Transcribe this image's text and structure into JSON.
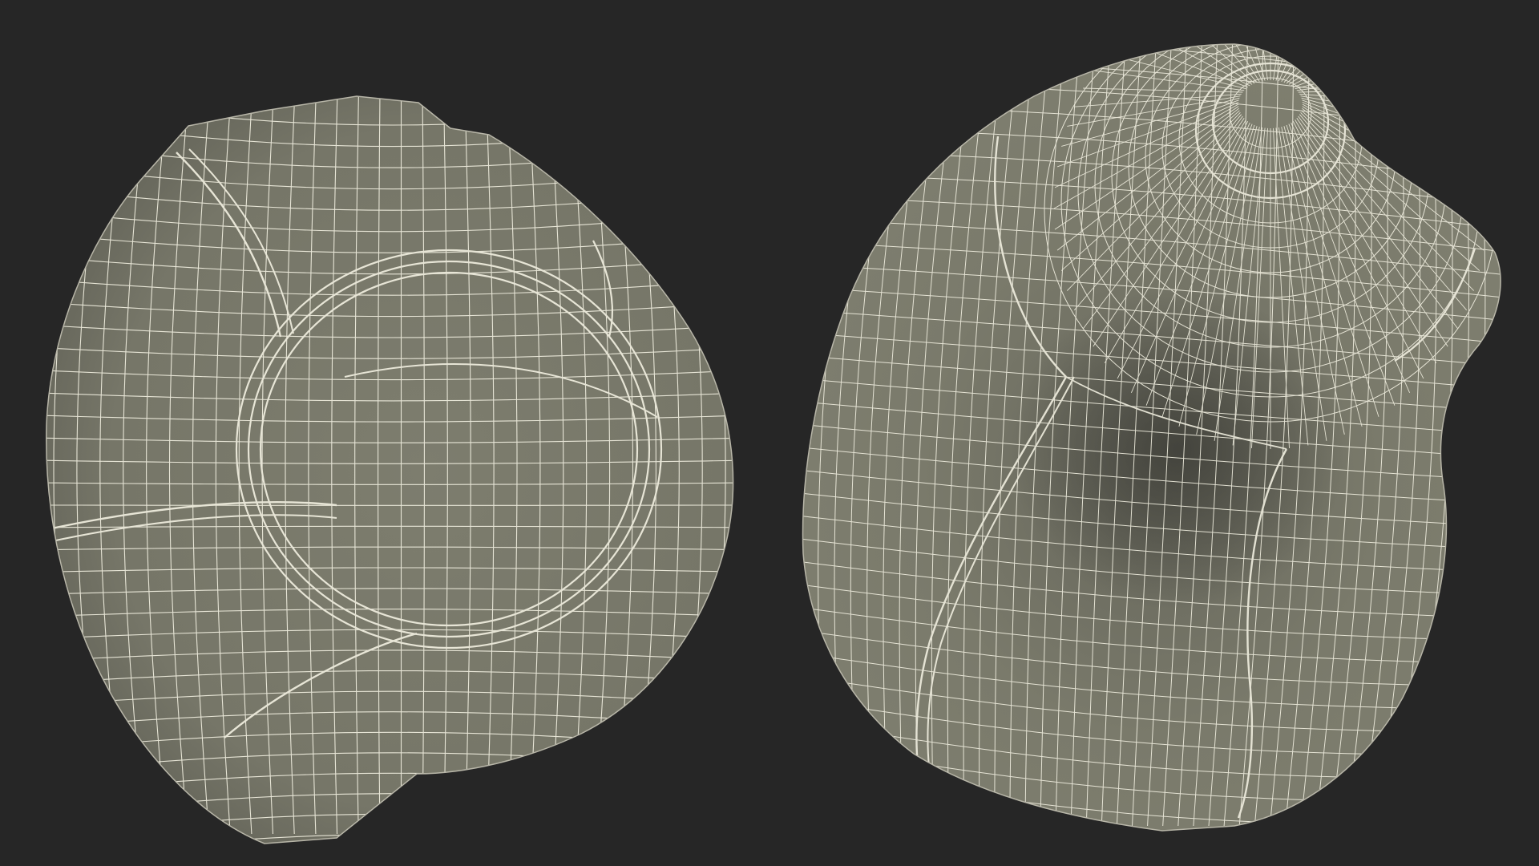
{
  "scene": {
    "background_color": "#262626",
    "mesh_fill_color": "#7b7b6c",
    "mesh_shadow_color": "#52524a",
    "wire_color": "#f1efe0",
    "objects": [
      {
        "id": "left",
        "description_name": "bean-bag-top-view-wireframe"
      },
      {
        "id": "right",
        "description_name": "bean-bag-perspective-view-wireframe"
      }
    ]
  }
}
